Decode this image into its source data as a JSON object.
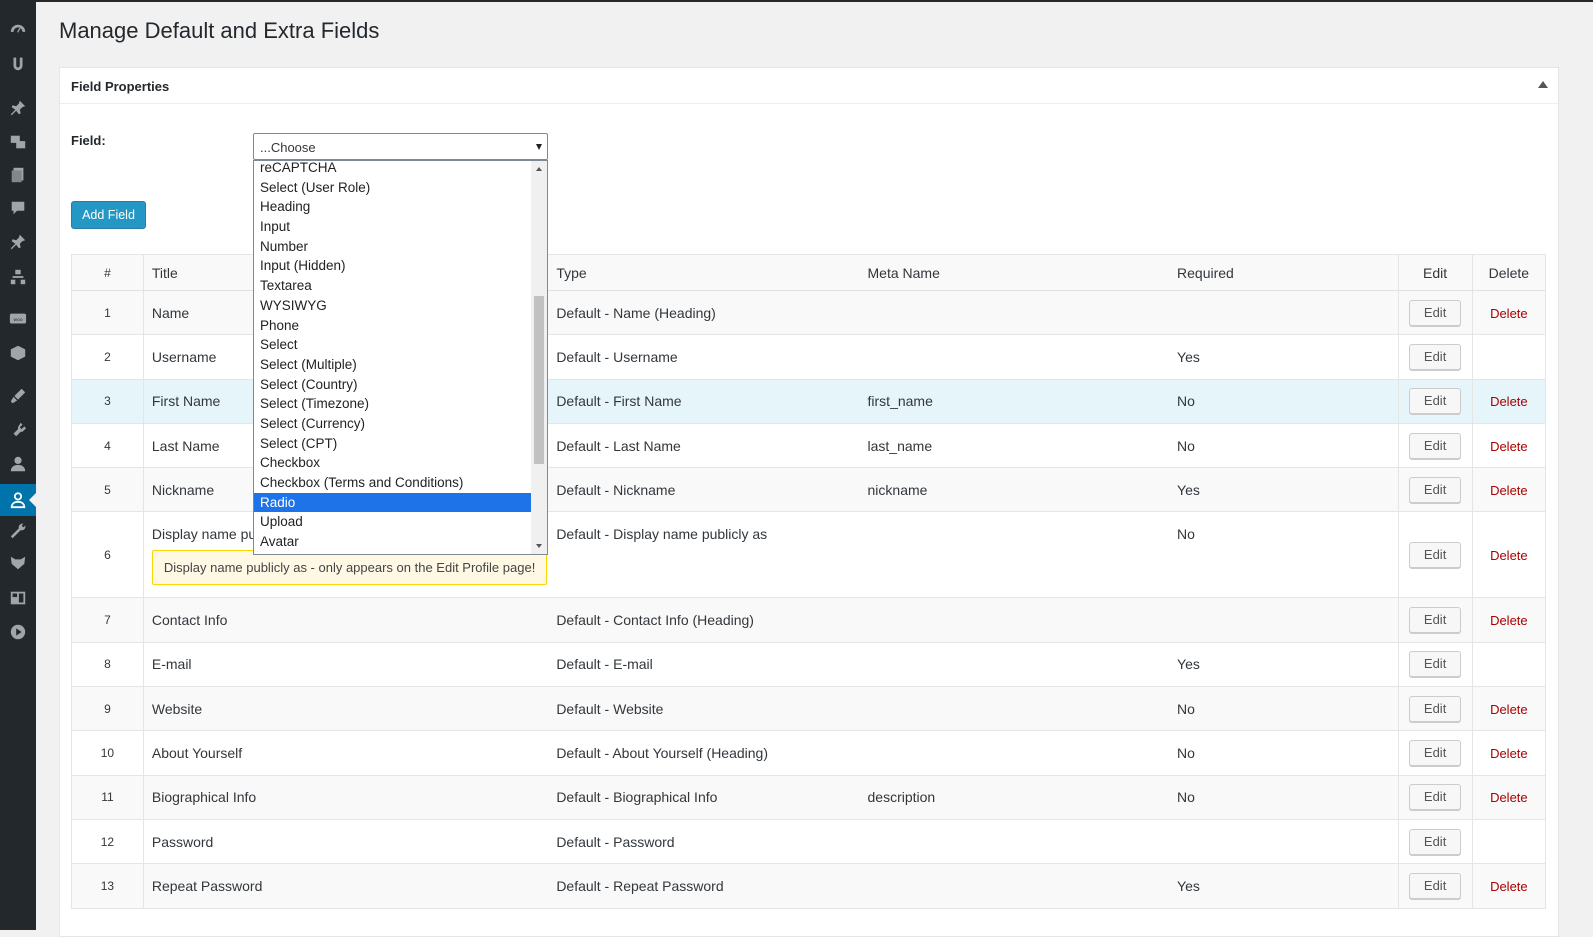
{
  "page": {
    "title": "Manage Default and Extra Fields"
  },
  "panel": {
    "title": "Field Properties"
  },
  "form": {
    "field_label": "Field:",
    "select_value": "...Choose",
    "add_button": "Add Field"
  },
  "dropdown_options": [
    "reCAPTCHA",
    "Select (User Role)",
    "Heading",
    "Input",
    "Number",
    "Input (Hidden)",
    "Textarea",
    "WYSIWYG",
    "Phone",
    "Select",
    "Select (Multiple)",
    "Select (Country)",
    "Select (Timezone)",
    "Select (Currency)",
    "Select (CPT)",
    "Checkbox",
    "Checkbox (Terms and Conditions)",
    "Radio",
    "Upload",
    "Avatar"
  ],
  "dropdown_selected": "Radio",
  "table": {
    "headers": {
      "num": "#",
      "title": "Title",
      "type": "Type",
      "meta": "Meta Name",
      "required": "Required",
      "edit": "Edit",
      "delete": "Delete"
    },
    "edit_label": "Edit",
    "delete_label": "Delete",
    "rows": [
      {
        "num": "1",
        "title": "Name",
        "type": "Default - Name (Heading)",
        "meta": "",
        "required": "",
        "delete": true
      },
      {
        "num": "2",
        "title": "Username",
        "type": "Default - Username",
        "meta": "",
        "required": "Yes",
        "delete": false
      },
      {
        "num": "3",
        "title": "First Name",
        "type": "Default - First Name",
        "meta": "first_name",
        "required": "No",
        "delete": true
      },
      {
        "num": "4",
        "title": "Last Name",
        "type": "Default - Last Name",
        "meta": "last_name",
        "required": "No",
        "delete": true
      },
      {
        "num": "5",
        "title": "Nickname",
        "type": "Default - Nickname",
        "meta": "nickname",
        "required": "Yes",
        "delete": true
      },
      {
        "num": "6",
        "title": "Display name publicly as",
        "type": "Default - Display name publicly as",
        "meta": "",
        "required": "No",
        "delete": true,
        "notice": "Display name publicly as - only appears on the Edit Profile page!"
      },
      {
        "num": "7",
        "title": "Contact Info",
        "type": "Default - Contact Info (Heading)",
        "meta": "",
        "required": "",
        "delete": true
      },
      {
        "num": "8",
        "title": "E-mail",
        "type": "Default - E-mail",
        "meta": "",
        "required": "Yes",
        "delete": false
      },
      {
        "num": "9",
        "title": "Website",
        "type": "Default - Website",
        "meta": "",
        "required": "No",
        "delete": true
      },
      {
        "num": "10",
        "title": "About Yourself",
        "type": "Default - About Yourself (Heading)",
        "meta": "",
        "required": "No",
        "delete": true
      },
      {
        "num": "11",
        "title": "Biographical Info",
        "type": "Default - Biographical Info",
        "meta": "description",
        "required": "No",
        "delete": true
      },
      {
        "num": "12",
        "title": "Password",
        "type": "Default - Password",
        "meta": "",
        "required": "",
        "delete": false
      },
      {
        "num": "13",
        "title": "Repeat Password",
        "type": "Default - Repeat Password",
        "meta": "",
        "required": "Yes",
        "delete": true
      }
    ]
  },
  "sidebar_icons": [
    "dashboard-icon",
    "plugin-logo-icon",
    "pin-icon",
    "media-icon",
    "pages-icon",
    "comments-icon",
    "pin-icon-2",
    "sitemap-icon",
    "woocommerce-icon",
    "products-icon",
    "appearance-icon",
    "plugins-icon",
    "users-icon",
    "profile-builder-icon",
    "tools-icon",
    "fox-icon",
    "layout-icon",
    "video-icon"
  ],
  "colors": {
    "accent": "#0073aa",
    "button": "#0085ba",
    "delete": "#aa0000",
    "highlight_row": "#e5f5fa",
    "selected_option": "#1e73e8"
  }
}
